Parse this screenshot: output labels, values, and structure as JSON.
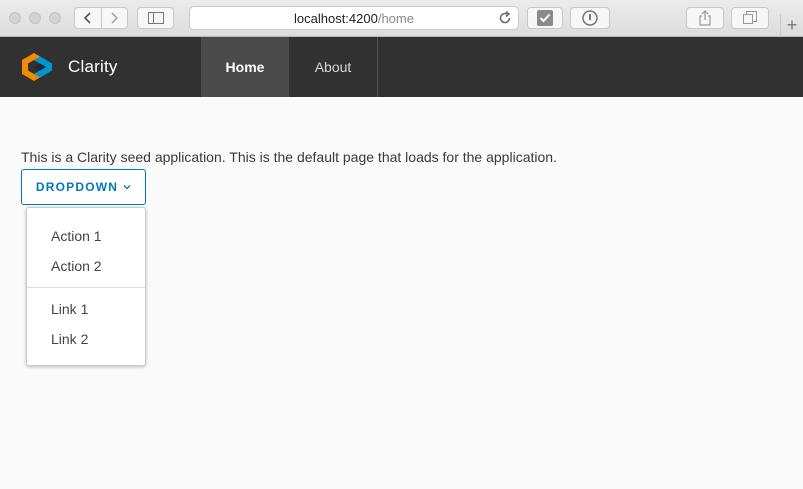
{
  "browser": {
    "url_host": "localhost:4200",
    "url_path": "/home",
    "new_tab_label": "+"
  },
  "header": {
    "brand": "Clarity",
    "nav": [
      {
        "label": "Home",
        "active": true
      },
      {
        "label": "About",
        "active": false
      }
    ],
    "colors": {
      "header_bg": "#313131",
      "active_tab": "#4a4a4a",
      "logo_orange": "#f38b00",
      "logo_blue": "#0095d3"
    }
  },
  "main": {
    "intro_text": "This is a Clarity seed application. This is the default page that loads for the application.",
    "dropdown": {
      "label": "DROPDOWN",
      "items": [
        "Action 1",
        "Action 2"
      ],
      "links": [
        "Link 1",
        "Link 2"
      ]
    },
    "colors": {
      "primary": "#0079b8"
    }
  }
}
